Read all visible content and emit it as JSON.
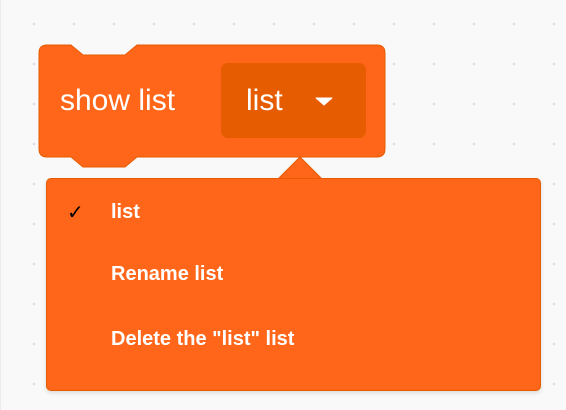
{
  "block": {
    "label": "show list",
    "field_value": "list",
    "colors": {
      "fill": "#ff661a",
      "stroke": "#e65c00",
      "field_fill": "#e65c00"
    }
  },
  "dropdown": {
    "items": [
      {
        "label": "list",
        "checked": true,
        "check_glyph": "✓"
      },
      {
        "label": "Rename list",
        "checked": false
      },
      {
        "label": "Delete the \"list\" list",
        "checked": false
      }
    ],
    "colors": {
      "background": "#ff661a",
      "text": "#ffffff",
      "check": "#000000"
    }
  },
  "icons": {
    "field_caret": "caret-down-icon",
    "checked_marker": "checkmark-icon"
  }
}
